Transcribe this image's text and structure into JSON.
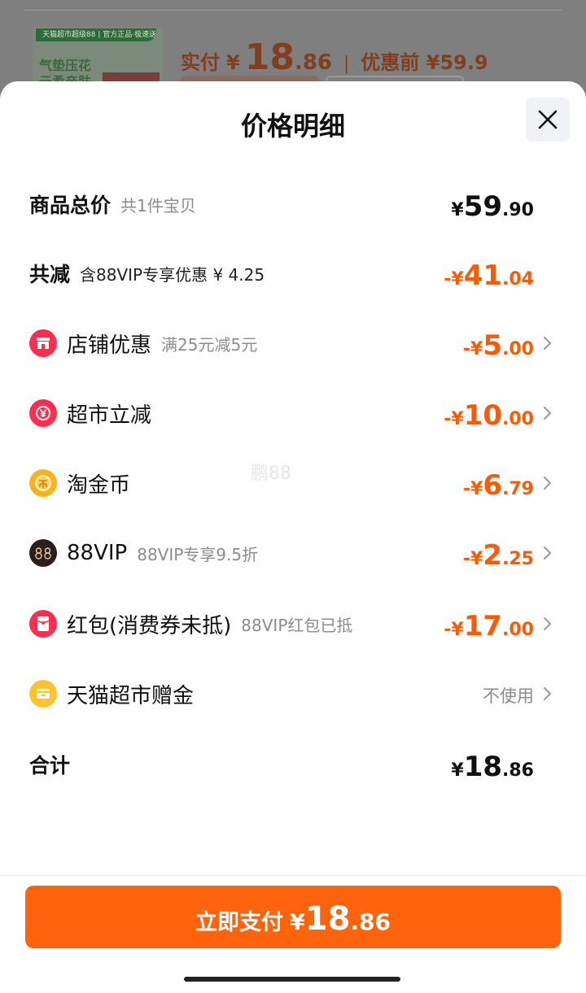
{
  "background": {
    "thumb_strip": "天猫超市超级88 | 官方正品·极速送达",
    "thumb_line1": "气垫压花",
    "thumb_line2": "云柔亲肤",
    "price_label": "实付",
    "price_yen": "¥",
    "price_int": "18",
    "price_dec": ".86",
    "separator": "|",
    "pre_discount": "优惠前 ¥59.9"
  },
  "sheet": {
    "title": "价格明细",
    "watermark": "鹏88"
  },
  "rows": {
    "total": {
      "label": "商品总价",
      "sub": "共1件宝贝",
      "yen": "¥",
      "int": "59",
      "dec": ".90"
    },
    "reduced": {
      "label": "共减",
      "sub": "含88VIP专享优惠 ¥ 4.25",
      "yen": "-¥",
      "int": "41",
      "dec": ".04"
    },
    "store": {
      "label": "店铺优惠",
      "sub": "满25元减5元",
      "yen": "-¥",
      "int": "5",
      "dec": ".00"
    },
    "supermarket": {
      "label": "超市立减",
      "sub": "",
      "yen": "-¥",
      "int": "10",
      "dec": ".00"
    },
    "coins": {
      "label": "淘金币",
      "sub": "",
      "yen": "-¥",
      "int": "6",
      "dec": ".79"
    },
    "vip": {
      "label": "88VIP",
      "sub": "88VIP专享9.5折",
      "yen": "-¥",
      "int": "2",
      "dec": ".25"
    },
    "redpacket": {
      "label": "红包(消费券未抵)",
      "sub": "88VIP红包已抵",
      "yen": "-¥",
      "int": "17",
      "dec": ".00"
    },
    "gift": {
      "label": "天猫超市赠金",
      "value": "不使用"
    },
    "sum": {
      "label": "合计",
      "yen": "¥",
      "int": "18",
      "dec": ".86"
    }
  },
  "pay_button": {
    "label": "立即支付",
    "yen": "¥",
    "int": "18",
    "dec": ".86"
  },
  "colors": {
    "accent": "#ff640c",
    "discount": "#ff5a00"
  },
  "icons": {
    "store": "store-icon",
    "supermarket": "yuan-coupon-icon",
    "coins": "coin-icon",
    "vip": "vip-88-icon",
    "redpacket": "red-packet-icon",
    "gift": "gift-wallet-icon"
  }
}
